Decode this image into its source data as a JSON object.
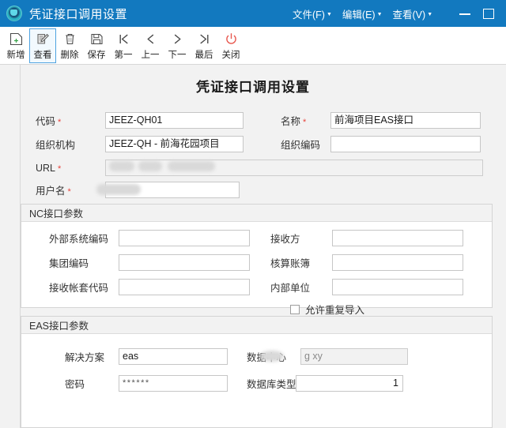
{
  "window": {
    "title": "凭证接口调用设置",
    "logo_icon": "app-logo-icon",
    "menus": [
      {
        "label": "文件(F)",
        "caret": "▼"
      },
      {
        "label": "编辑(E)",
        "caret": "▼"
      },
      {
        "label": "查看(V)",
        "caret": "▼"
      }
    ],
    "controls": {
      "minimize": "minimize-icon",
      "maximize": "maximize-icon"
    },
    "accent_color": "#1279bf"
  },
  "toolbar": {
    "buttons": [
      {
        "label": "新增",
        "icon": "add-icon",
        "selected": false
      },
      {
        "label": "查看",
        "icon": "view-edit-icon",
        "selected": true
      },
      {
        "label": "删除",
        "icon": "trash-icon",
        "selected": false
      },
      {
        "label": "保存",
        "icon": "save-icon",
        "selected": false
      },
      {
        "label": "第一",
        "icon": "first-record-icon",
        "selected": false
      },
      {
        "label": "上一",
        "icon": "previous-record-icon",
        "selected": false
      },
      {
        "label": "下一",
        "icon": "next-record-icon",
        "selected": false
      },
      {
        "label": "最后",
        "icon": "last-record-icon",
        "selected": false
      },
      {
        "label": "关闭",
        "icon": "power-close-icon",
        "selected": false
      }
    ],
    "selected_border_color": "#4ea3e0"
  },
  "page": {
    "title": "凭证接口调用设置"
  },
  "main_form": {
    "code": {
      "label": "代码",
      "required": "*",
      "value": "JEEZ-QH01"
    },
    "name": {
      "label": "名称",
      "required": "*",
      "value": "前海项目EAS接口"
    },
    "org": {
      "label": "组织机构",
      "required": "",
      "value": "JEEZ-QH  - 前海花园项目"
    },
    "org_code": {
      "label": "组织编码",
      "required": "",
      "value": ""
    },
    "url": {
      "label": "URL",
      "required": "*",
      "value": "",
      "redacted": true
    },
    "username": {
      "label": "用户名",
      "required": "*",
      "value": "",
      "redacted": true
    }
  },
  "nc_section": {
    "title": "NC接口参数",
    "fields": [
      {
        "label": "外部系统编码",
        "value": ""
      },
      {
        "label": "集团编码",
        "value": ""
      },
      {
        "label": "接收帐套代码",
        "value": ""
      },
      {
        "label": "接收方",
        "value": ""
      },
      {
        "label": "核算账簿",
        "value": ""
      },
      {
        "label": "内部单位",
        "value": ""
      }
    ],
    "checkbox": {
      "label": "允许重复导入",
      "checked": false
    }
  },
  "eas_section": {
    "title": "EAS接口参数",
    "fields": [
      {
        "label": "解决方案",
        "value": "eas"
      },
      {
        "label": "密码",
        "value": "******"
      },
      {
        "label": "数据中心",
        "value": "g        xy",
        "redacted": true
      },
      {
        "label": "数据库类型",
        "value": "1"
      }
    ]
  }
}
